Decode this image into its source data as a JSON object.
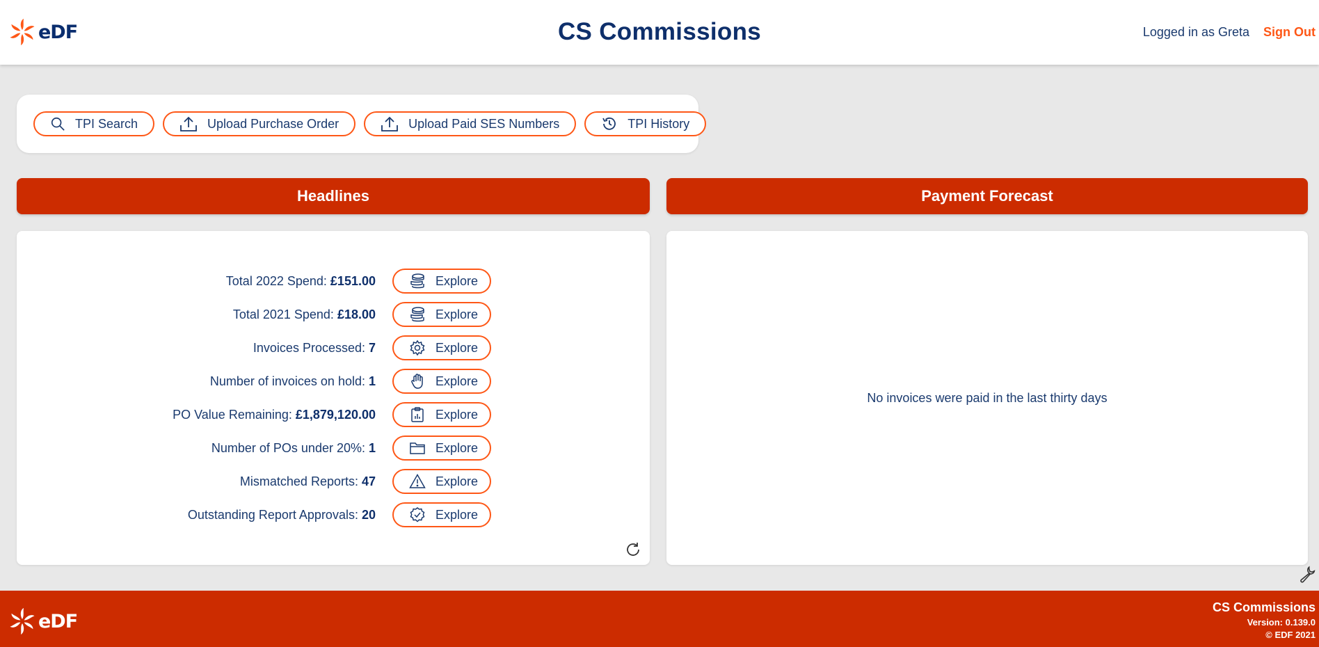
{
  "header": {
    "logo_text": "eDF",
    "title": "CS Commissions",
    "user_label": "Logged in as Greta",
    "sign_out_label": "Sign Out"
  },
  "toolbar": {
    "buttons": [
      {
        "label": "TPI Search",
        "icon": "search-icon"
      },
      {
        "label": "Upload Purchase Order",
        "icon": "upload-icon"
      },
      {
        "label": "Upload Paid SES Numbers",
        "icon": "upload-icon"
      },
      {
        "label": "TPI History",
        "icon": "history-icon"
      }
    ]
  },
  "headlines": {
    "title": "Headlines",
    "explore_label": "Explore",
    "rows": [
      {
        "label": "Total 2022 Spend: ",
        "value": "£151.00",
        "icon": "coins-icon"
      },
      {
        "label": "Total 2021 Spend: ",
        "value": "£18.00",
        "icon": "coins-icon"
      },
      {
        "label": "Invoices Processed: ",
        "value": "7",
        "icon": "gear-icon"
      },
      {
        "label": "Number of invoices on hold: ",
        "value": "1",
        "icon": "hand-icon"
      },
      {
        "label": "PO Value Remaining: ",
        "value": "£1,879,120.00",
        "icon": "clipboard-chart-icon"
      },
      {
        "label": "Number of POs under 20%: ",
        "value": "1",
        "icon": "folder-icon"
      },
      {
        "label": "Mismatched Reports: ",
        "value": "47",
        "icon": "warning-icon"
      },
      {
        "label": "Outstanding Report Approvals: ",
        "value": "20",
        "icon": "badge-check-icon"
      }
    ]
  },
  "payment_forecast": {
    "title": "Payment Forecast",
    "empty_message": "No invoices were paid in the last thirty days"
  },
  "footer": {
    "logo_text": "eDF",
    "title": "CS Commissions",
    "version": "Version: 0.139.0",
    "copyright": "© EDF 2021"
  },
  "colors": {
    "brand_orange": "#fe5716",
    "brand_red": "#cc2c00",
    "navy": "#0e2f6b",
    "background": "#e8e8e8"
  }
}
